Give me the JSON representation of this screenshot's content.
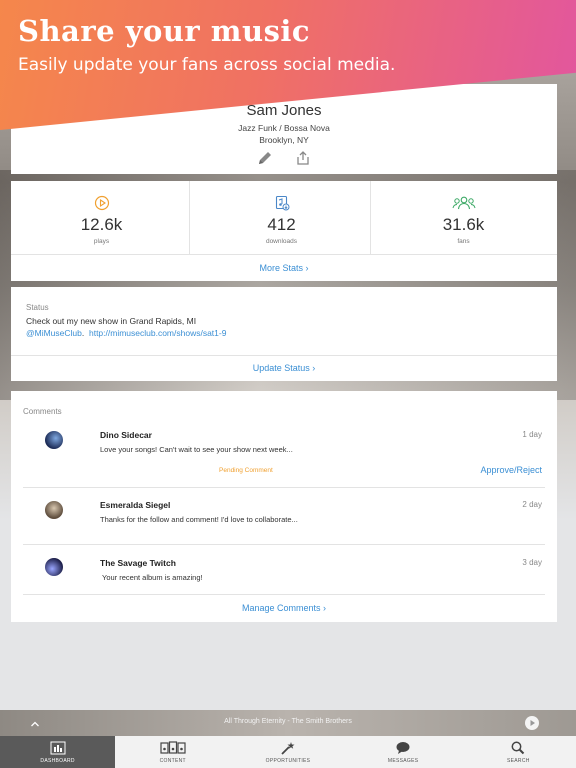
{
  "banner": {
    "title": "Share your music",
    "subtitle": "Easily update your fans across social media."
  },
  "profile": {
    "name": "Sam Jones",
    "genre": "Jazz Funk / Bossa Nova",
    "location": "Brooklyn, NY",
    "icons": [
      "pencil-icon",
      "share-icon"
    ]
  },
  "stats": {
    "items": [
      {
        "value": "12.6k",
        "label": "plays",
        "icon": "play-circle-icon"
      },
      {
        "value": "412",
        "label": "downloads",
        "icon": "download-icon"
      },
      {
        "value": "31.6k",
        "label": "fans",
        "icon": "fans-icon"
      }
    ],
    "more_label": "More Stats ›"
  },
  "status": {
    "caption": "Status",
    "text": "Check out my new show in Grand Rapids, MI",
    "handle": "@MiMuseClub",
    "separator": ".",
    "url": "http://mimuseclub.com/shows/sat1-9",
    "update_label": "Update Status ›"
  },
  "comments": {
    "caption": "Comments",
    "items": [
      {
        "name": "Dino Sidecar",
        "text": "Love your songs! Can't wait to see your show next week...",
        "time": "1 day",
        "pending": "Pending Comment",
        "action": "Approve/Reject"
      },
      {
        "name": "Esmeralda Siegel",
        "text": "Thanks for the follow and comment! I'd love to collaborate...",
        "time": "2 day"
      },
      {
        "name": "The Savage Twitch",
        "text": "Your recent album is amazing!",
        "time": "3 day"
      }
    ],
    "manage_label": "Manage Comments ›"
  },
  "player": {
    "track": "All Through Eternity - The Smith Brothers"
  },
  "tabs": [
    {
      "label": "DASHBOARD",
      "icon": "dashboard-icon",
      "active": true
    },
    {
      "label": "CONTENT",
      "icon": "content-icon"
    },
    {
      "label": "OPPORTUNITIES",
      "icon": "opportunities-icon"
    },
    {
      "label": "MESSAGES",
      "icon": "messages-icon"
    },
    {
      "label": "SEARCH",
      "icon": "search-icon"
    }
  ],
  "colors": {
    "accent": "#3b8fd4",
    "pending": "#f0a030",
    "plays_icon": "#f0a030",
    "downloads_icon": "#4a87c8",
    "fans_icon": "#3aa864",
    "banner_start": "#f5874b",
    "banner_end": "#e2569e"
  }
}
